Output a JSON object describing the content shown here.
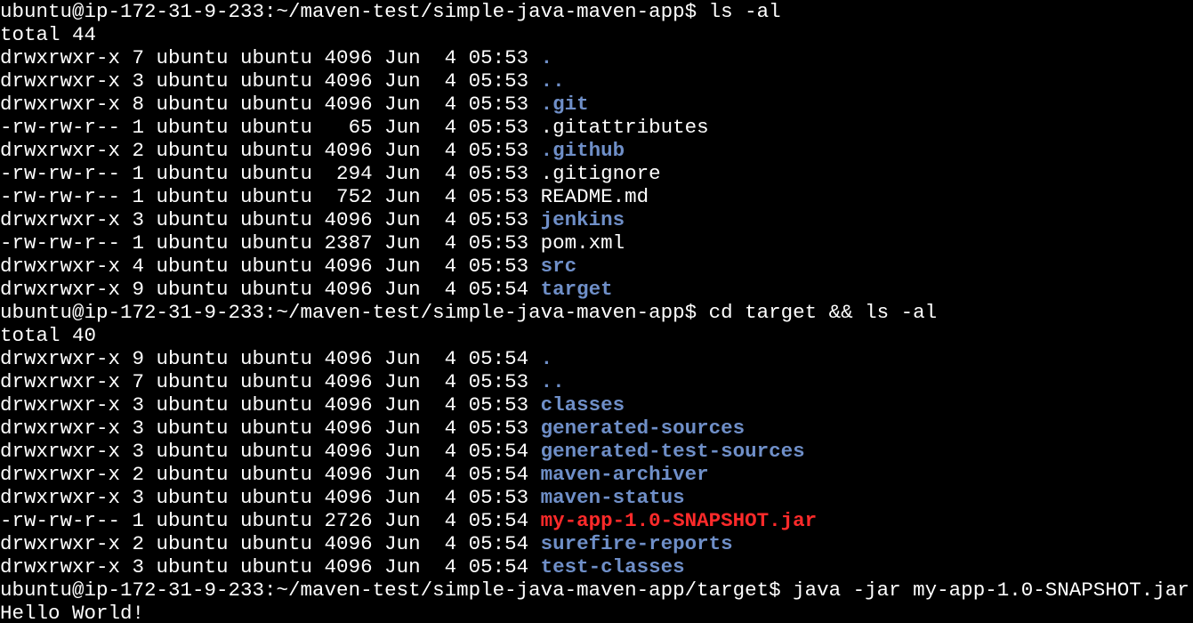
{
  "terminal": {
    "colors": {
      "background": "#000000",
      "foreground": "#ffffff",
      "directory": "#6f8fc8",
      "highlight_file": "#ff2a2a"
    },
    "lines": [
      {
        "kind": "prompt",
        "prompt": "ubuntu@ip-172-31-9-233:~/maven-test/simple-java-maven-app$ ",
        "command": "ls -al"
      },
      {
        "kind": "text",
        "text": "total 44"
      },
      {
        "kind": "entry",
        "meta": "drwxrwxr-x 7 ubuntu ubuntu 4096 Jun  4 05:53 ",
        "name": ".",
        "type": "dir"
      },
      {
        "kind": "entry",
        "meta": "drwxrwxr-x 3 ubuntu ubuntu 4096 Jun  4 05:53 ",
        "name": "..",
        "type": "dir"
      },
      {
        "kind": "entry",
        "meta": "drwxrwxr-x 8 ubuntu ubuntu 4096 Jun  4 05:53 ",
        "name": ".git",
        "type": "dir"
      },
      {
        "kind": "entry",
        "meta": "-rw-rw-r-- 1 ubuntu ubuntu   65 Jun  4 05:53 ",
        "name": ".gitattributes",
        "type": "file"
      },
      {
        "kind": "entry",
        "meta": "drwxrwxr-x 2 ubuntu ubuntu 4096 Jun  4 05:53 ",
        "name": ".github",
        "type": "dir"
      },
      {
        "kind": "entry",
        "meta": "-rw-rw-r-- 1 ubuntu ubuntu  294 Jun  4 05:53 ",
        "name": ".gitignore",
        "type": "file"
      },
      {
        "kind": "entry",
        "meta": "-rw-rw-r-- 1 ubuntu ubuntu  752 Jun  4 05:53 ",
        "name": "README.md",
        "type": "file"
      },
      {
        "kind": "entry",
        "meta": "drwxrwxr-x 3 ubuntu ubuntu 4096 Jun  4 05:53 ",
        "name": "jenkins",
        "type": "dir"
      },
      {
        "kind": "entry",
        "meta": "-rw-rw-r-- 1 ubuntu ubuntu 2387 Jun  4 05:53 ",
        "name": "pom.xml",
        "type": "file"
      },
      {
        "kind": "entry",
        "meta": "drwxrwxr-x 4 ubuntu ubuntu 4096 Jun  4 05:53 ",
        "name": "src",
        "type": "dir"
      },
      {
        "kind": "entry",
        "meta": "drwxrwxr-x 9 ubuntu ubuntu 4096 Jun  4 05:54 ",
        "name": "target",
        "type": "dir"
      },
      {
        "kind": "prompt",
        "prompt": "ubuntu@ip-172-31-9-233:~/maven-test/simple-java-maven-app$ ",
        "command": "cd target && ls -al"
      },
      {
        "kind": "text",
        "text": "total 40"
      },
      {
        "kind": "entry",
        "meta": "drwxrwxr-x 9 ubuntu ubuntu 4096 Jun  4 05:54 ",
        "name": ".",
        "type": "dir"
      },
      {
        "kind": "entry",
        "meta": "drwxrwxr-x 7 ubuntu ubuntu 4096 Jun  4 05:53 ",
        "name": "..",
        "type": "dir"
      },
      {
        "kind": "entry",
        "meta": "drwxrwxr-x 3 ubuntu ubuntu 4096 Jun  4 05:53 ",
        "name": "classes",
        "type": "dir"
      },
      {
        "kind": "entry",
        "meta": "drwxrwxr-x 3 ubuntu ubuntu 4096 Jun  4 05:53 ",
        "name": "generated-sources",
        "type": "dir"
      },
      {
        "kind": "entry",
        "meta": "drwxrwxr-x 3 ubuntu ubuntu 4096 Jun  4 05:54 ",
        "name": "generated-test-sources",
        "type": "dir"
      },
      {
        "kind": "entry",
        "meta": "drwxrwxr-x 2 ubuntu ubuntu 4096 Jun  4 05:54 ",
        "name": "maven-archiver",
        "type": "dir"
      },
      {
        "kind": "entry",
        "meta": "drwxrwxr-x 3 ubuntu ubuntu 4096 Jun  4 05:53 ",
        "name": "maven-status",
        "type": "dir"
      },
      {
        "kind": "entry",
        "meta": "-rw-rw-r-- 1 ubuntu ubuntu 2726 Jun  4 05:54 ",
        "name": "my-app-1.0-SNAPSHOT.jar",
        "type": "jar"
      },
      {
        "kind": "entry",
        "meta": "drwxrwxr-x 2 ubuntu ubuntu 4096 Jun  4 05:54 ",
        "name": "surefire-reports",
        "type": "dir"
      },
      {
        "kind": "entry",
        "meta": "drwxrwxr-x 3 ubuntu ubuntu 4096 Jun  4 05:54 ",
        "name": "test-classes",
        "type": "dir"
      },
      {
        "kind": "prompt",
        "prompt": "ubuntu@ip-172-31-9-233:~/maven-test/simple-java-maven-app/target$ ",
        "command": "java -jar my-app-1.0-SNAPSHOT.jar"
      },
      {
        "kind": "text",
        "text": "Hello World!"
      }
    ]
  }
}
